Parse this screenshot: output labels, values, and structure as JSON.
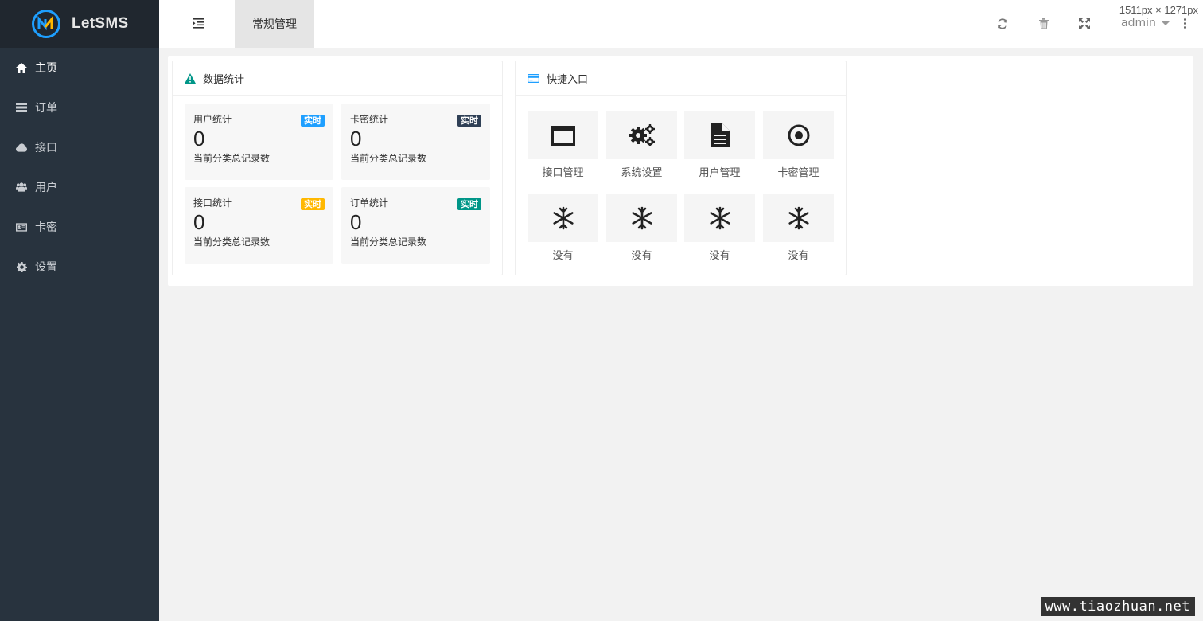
{
  "app": {
    "name": "LetSMS"
  },
  "sidebar": {
    "items": [
      {
        "label": "主页",
        "icon": "home-icon",
        "active": true
      },
      {
        "label": "订单",
        "icon": "server-icon"
      },
      {
        "label": "接口",
        "icon": "cloud-icon"
      },
      {
        "label": "用户",
        "icon": "users-icon"
      },
      {
        "label": "卡密",
        "icon": "id-card-icon"
      },
      {
        "label": "设置",
        "icon": "gear-icon"
      }
    ]
  },
  "header": {
    "active_tab": "常规管理",
    "user": "admin",
    "dimensions": "1511px × 1271px"
  },
  "stats_card": {
    "title": "数据统计",
    "boxes": [
      {
        "title": "用户统计",
        "value": "0",
        "desc": "当前分类总记录数",
        "badge": "实时",
        "badge_color": "#1e9fff"
      },
      {
        "title": "卡密统计",
        "value": "0",
        "desc": "当前分类总记录数",
        "badge": "实时",
        "badge_color": "#2f4056"
      },
      {
        "title": "接口统计",
        "value": "0",
        "desc": "当前分类总记录数",
        "badge": "实时",
        "badge_color": "#ffb800"
      },
      {
        "title": "订单统计",
        "value": "0",
        "desc": "当前分类总记录数",
        "badge": "实时",
        "badge_color": "#009688"
      }
    ]
  },
  "quick_card": {
    "title": "快捷入口",
    "items": [
      {
        "label": "接口管理",
        "icon": "window-icon"
      },
      {
        "label": "系统设置",
        "icon": "gears-icon"
      },
      {
        "label": "用户管理",
        "icon": "document-icon"
      },
      {
        "label": "卡密管理",
        "icon": "dot-circle-icon"
      },
      {
        "label": "没有",
        "icon": "snowflake-icon"
      },
      {
        "label": "没有",
        "icon": "snowflake-icon"
      },
      {
        "label": "没有",
        "icon": "snowflake-icon"
      },
      {
        "label": "没有",
        "icon": "snowflake-icon"
      }
    ]
  },
  "colors": {
    "sidebar_bg": "#28333e",
    "logo_bg": "#20272f",
    "accent": "#1e9fff",
    "warning_icon": "#009688"
  },
  "watermark": "www.tiaozhuan.net"
}
